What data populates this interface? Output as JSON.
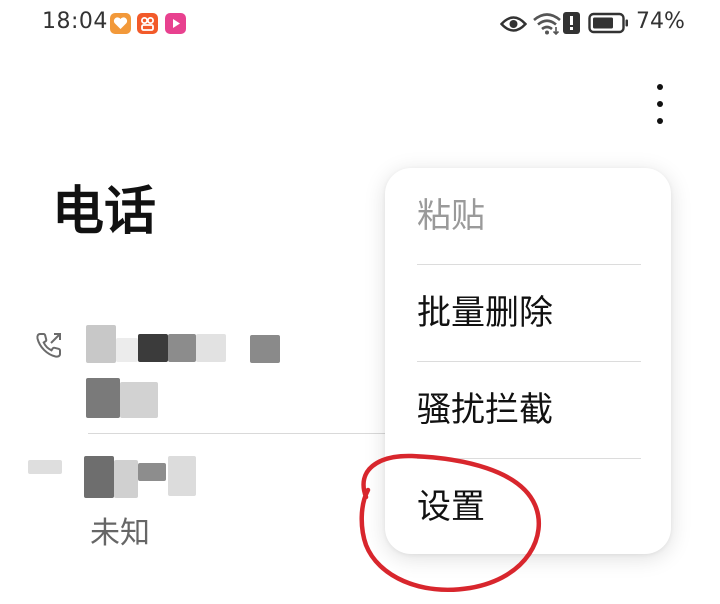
{
  "status_bar": {
    "time": "18:04",
    "battery_percent": "74%",
    "app_icons": [
      "heart-app-icon",
      "people-app-icon",
      "video-play-app-icon"
    ],
    "right_icons": [
      "eye-icon",
      "wifi-icon",
      "alert-icon",
      "battery-icon"
    ],
    "battery_level": 0.74
  },
  "header": {
    "title": "电话",
    "overflow_icon": "more-vertical-icon"
  },
  "call_log": {
    "items": [
      {
        "icon": "outgoing-call-icon",
        "name": "",
        "detail": ""
      },
      {
        "icon": "incoming-call-icon",
        "name": "",
        "detail": "未知"
      }
    ]
  },
  "popup_menu": {
    "items": [
      {
        "label": "粘贴",
        "enabled": false
      },
      {
        "label": "批量删除",
        "enabled": true
      },
      {
        "label": "骚扰拦截",
        "enabled": true
      },
      {
        "label": "设置",
        "enabled": true
      }
    ]
  },
  "colors": {
    "annotation": "#d8262d",
    "text_primary": "#111111",
    "text_disabled": "#9a9a9a",
    "text_secondary": "#666666"
  }
}
